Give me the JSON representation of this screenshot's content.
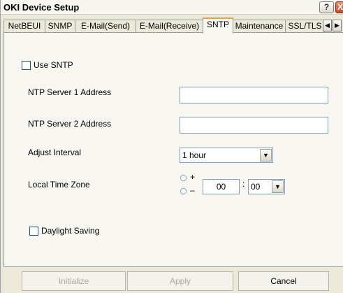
{
  "window": {
    "title": "OKI Device Setup",
    "help_glyph": "?",
    "close_glyph": "X"
  },
  "tabs": [
    {
      "label": "NetBEUI"
    },
    {
      "label": "SNMP"
    },
    {
      "label": "E-Mail(Send)"
    },
    {
      "label": "E-Mail(Receive)"
    },
    {
      "label": "SNTP",
      "active": true
    },
    {
      "label": "Maintenance"
    },
    {
      "label": "SSL/TLS"
    }
  ],
  "tab_scroll": {
    "left_glyph": "◀",
    "right_glyph": "▶"
  },
  "sntp": {
    "use_sntp_label": "Use SNTP",
    "use_sntp_checked": false,
    "ntp1_label": "NTP Server 1 Address",
    "ntp1_value": "",
    "ntp2_label": "NTP Server 2 Address",
    "ntp2_value": "",
    "interval_label": "Adjust Interval",
    "interval_value": "1 hour",
    "timezone_label": "Local Time Zone",
    "plus_label": "+",
    "minus_label": "–",
    "hours_value": "00",
    "separator": ":",
    "minutes_value": "00",
    "daylight_label": "Daylight Saving",
    "daylight_checked": false
  },
  "buttons": {
    "initialize": "Initialize",
    "apply": "Apply",
    "cancel": "Cancel"
  },
  "colors": {
    "active_tab_accent": "#e7a33c",
    "close_button": "#c9492e",
    "disabled_text": "#aca899"
  }
}
